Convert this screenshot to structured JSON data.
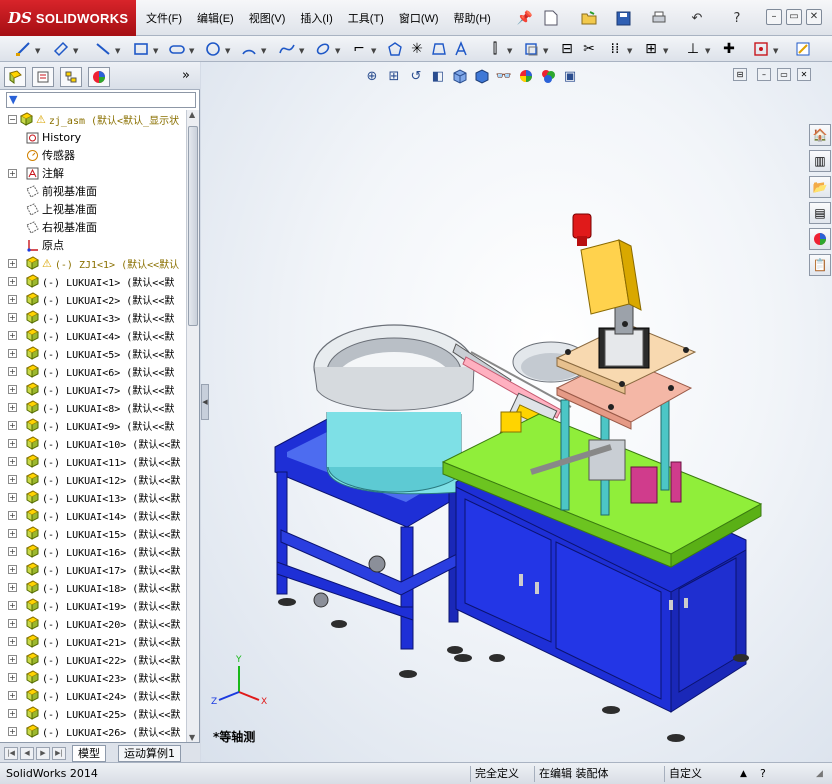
{
  "app": {
    "brand_ds": "DS",
    "brand_name": "SOLIDWORKS"
  },
  "menu": [
    "文件(F)",
    "编辑(E)",
    "视图(V)",
    "插入(I)",
    "工具(T)",
    "窗口(W)",
    "帮助(H)"
  ],
  "tree": {
    "root_label": "zj_asm  (默认<默认_显示状",
    "items": [
      {
        "label": "History",
        "icon": "history-icon",
        "expandable": false
      },
      {
        "label": "传感器",
        "icon": "sensors-icon",
        "expandable": false
      },
      {
        "label": "注解",
        "icon": "annotations-icon",
        "expandable": true
      },
      {
        "label": "前视基准面",
        "icon": "plane-icon",
        "expandable": false
      },
      {
        "label": "上视基准面",
        "icon": "plane-icon",
        "expandable": false
      },
      {
        "label": "右视基准面",
        "icon": "plane-icon",
        "expandable": false
      },
      {
        "label": "原点",
        "icon": "origin-icon",
        "expandable": false
      }
    ],
    "components": [
      {
        "label": "(-) ZJ1<1>  (默认<<默认",
        "warning": true
      },
      {
        "label": "(-) LUKUAI<1>  (默认<<默"
      },
      {
        "label": "(-) LUKUAI<2>  (默认<<默"
      },
      {
        "label": "(-) LUKUAI<3>  (默认<<默"
      },
      {
        "label": "(-) LUKUAI<4>  (默认<<默"
      },
      {
        "label": "(-) LUKUAI<5>  (默认<<默"
      },
      {
        "label": "(-) LUKUAI<6>  (默认<<默"
      },
      {
        "label": "(-) LUKUAI<7>  (默认<<默"
      },
      {
        "label": "(-) LUKUAI<8>  (默认<<默"
      },
      {
        "label": "(-) LUKUAI<9>  (默认<<默"
      },
      {
        "label": "(-) LUKUAI<10>  (默认<<默"
      },
      {
        "label": "(-) LUKUAI<11>  (默认<<默"
      },
      {
        "label": "(-) LUKUAI<12>  (默认<<默"
      },
      {
        "label": "(-) LUKUAI<13>  (默认<<默"
      },
      {
        "label": "(-) LUKUAI<14>  (默认<<默"
      },
      {
        "label": "(-) LUKUAI<15>  (默认<<默"
      },
      {
        "label": "(-) LUKUAI<16>  (默认<<默"
      },
      {
        "label": "(-) LUKUAI<17>  (默认<<默"
      },
      {
        "label": "(-) LUKUAI<18>  (默认<<默"
      },
      {
        "label": "(-) LUKUAI<19>  (默认<<默"
      },
      {
        "label": "(-) LUKUAI<20>  (默认<<默"
      },
      {
        "label": "(-) LUKUAI<21>  (默认<<默"
      },
      {
        "label": "(-) LUKUAI<22>  (默认<<默"
      },
      {
        "label": "(-) LUKUAI<23>  (默认<<默"
      },
      {
        "label": "(-) LUKUAI<24>  (默认<<默"
      },
      {
        "label": "(-) LUKUAI<25>  (默认<<默"
      },
      {
        "label": "(-) LUKUAI<26>  (默认<<默"
      }
    ]
  },
  "bottom_tabs": [
    "模型",
    "运动算例1"
  ],
  "viewport": {
    "view_label": "*等轴测",
    "triad": {
      "x": "X",
      "y": "Y",
      "z": "Z"
    }
  },
  "status": {
    "app_version": "SolidWorks 2014",
    "definition": "完全定义",
    "edit_mode": "在编辑 装配体",
    "units": "自定义"
  },
  "colors": {
    "brand_red": "#c8161d",
    "cabinet_blue": "#1e2fd6",
    "table_top_green": "#90ee3a",
    "bowl_cyan": "#7ee0e6",
    "plate_pink": "#f4b7a6",
    "part_yellow": "#ffd400"
  }
}
